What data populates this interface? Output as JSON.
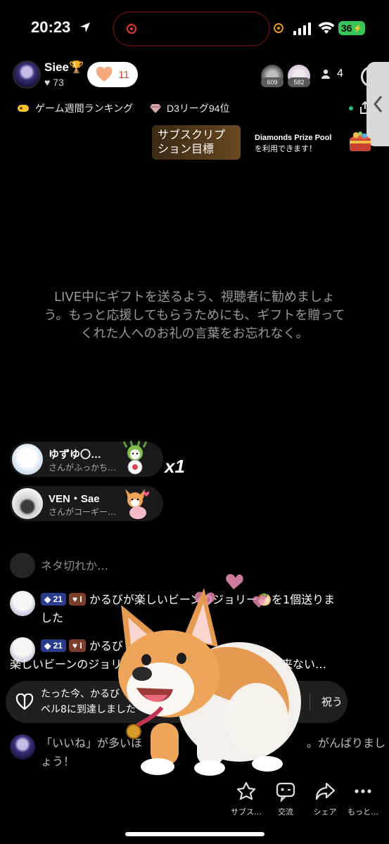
{
  "status_bar": {
    "time": "20:23",
    "battery": "36"
  },
  "host": {
    "name": "Siee🏆",
    "likes": "73"
  },
  "like_pill": {
    "count": "11"
  },
  "viewers": [
    {
      "badge": "609"
    },
    {
      "badge": "582"
    }
  ],
  "viewer_count": "4",
  "rank_row": {
    "weekly_ranking": "ゲーム週間ランキング",
    "league": "D3リーグ94位"
  },
  "subscription": {
    "label_line1": "サブスクリプ",
    "label_line2": "ション目標"
  },
  "prize_pool": {
    "line1": "Diamonds Prize Pool",
    "line2": "を利用できます！"
  },
  "center_message": {
    "line1": "LIVE中にギフトを送るよう、視聴者に勧めましょ",
    "line2": "う。もっと応援してもらうためにも、ギフトを贈って",
    "line3": "くれた人へのお礼の言葉をお忘れなく。"
  },
  "gifts": [
    {
      "user": "ゆずゆ〇…",
      "desc": "さんがふっかち…",
      "count": "x1"
    },
    {
      "user": "VEN・Sae",
      "desc": "さんがコーギー…"
    }
  ],
  "chat": {
    "faded_text": "ネタ切れか…",
    "msg1": {
      "level": "21",
      "fan": "I",
      "line1": "かるびが楽しいビーンのジョリー🥙を1個送りま",
      "line2": "した"
    },
    "msg2": {
      "level": "21",
      "fan": "I",
      "line1": "かるび",
      "line2": "楽しいビーンのジョリー…",
      "tail": "来ない…"
    },
    "notice": {
      "line1": "たった今、かるび",
      "line2": "ベル8に到達しました",
      "button": "祝う"
    },
    "host_msg": {
      "line1": "「いいね」が多いほ",
      "line1_tail": "。がんばりまし",
      "line2": "ょう！"
    }
  },
  "actions": [
    {
      "label": "サブス…",
      "icon": "subscription-icon"
    },
    {
      "label": "交流",
      "icon": "interact-icon"
    },
    {
      "label": "シェア",
      "icon": "share-icon"
    },
    {
      "label": "もっと…",
      "icon": "more-icon"
    }
  ],
  "colors": {
    "background": "#000000",
    "battery": "#39c659",
    "like_heart": "#f4a97c",
    "level_badge": "#2a3a8c",
    "fan_badge": "#7b3e2a"
  }
}
